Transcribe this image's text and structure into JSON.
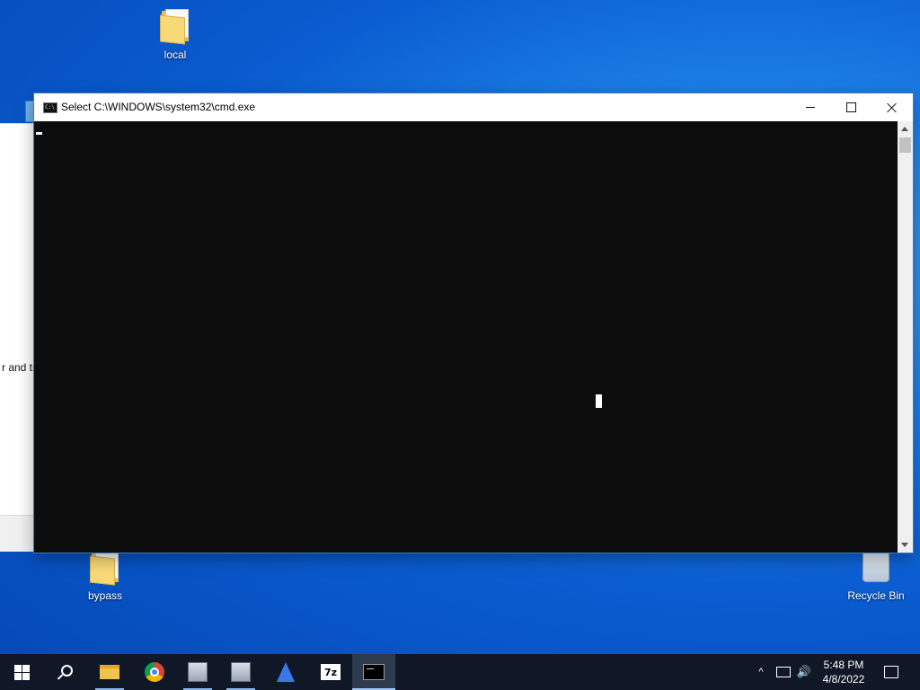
{
  "desktop": {
    "icons": [
      {
        "label": "local"
      },
      {
        "label": "bypass"
      },
      {
        "label": "Recycle Bin"
      }
    ]
  },
  "background_window": {
    "visible_text": "r and try"
  },
  "cmd_window": {
    "title": "Select C:\\WINDOWS\\system32\\cmd.exe",
    "buttons": {
      "minimize": "minimize",
      "maximize": "maximize",
      "close": "close"
    },
    "console": {
      "background": "#0c0c0c",
      "foreground": "#f2f2f2"
    }
  },
  "taskbar": {
    "items": [
      {
        "icon": "windows-start-icon"
      },
      {
        "icon": "search-icon"
      },
      {
        "icon": "file-explorer-icon"
      },
      {
        "icon": "chrome-icon"
      },
      {
        "icon": "app-icon"
      },
      {
        "icon": "app-icon"
      },
      {
        "icon": "wireshark-icon"
      },
      {
        "icon": "7zip-icon",
        "label": "7z"
      },
      {
        "icon": "command-prompt-icon",
        "active": true
      }
    ],
    "tray": {
      "time": "5:48 PM",
      "date": "4/8/2022"
    }
  },
  "colors": {
    "taskbar": "#101827",
    "accent": "#3b78c4"
  }
}
